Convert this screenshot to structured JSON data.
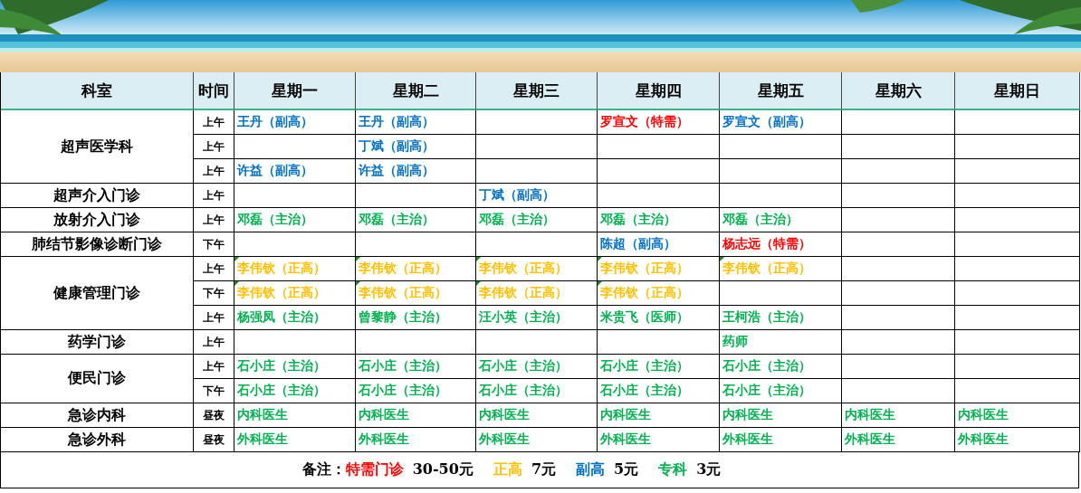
{
  "table": {
    "columns": [
      "科室",
      "时间",
      "星期一",
      "星期二",
      "星期三",
      "星期四",
      "星期五",
      "星期六",
      "星期日"
    ],
    "departments": [
      {
        "name": "超声医学科",
        "slots": [
          {
            "time": "上午",
            "cells": [
              {
                "text": "王丹（副高）",
                "color": "#0070c0",
                "marked": false
              },
              {
                "text": "王丹（副高）",
                "color": "#0070c0",
                "marked": false
              },
              null,
              {
                "text": "罗宣文（特需）",
                "color": "#ff0000",
                "marked": false
              },
              {
                "text": "罗宣文（副高）",
                "color": "#0070c0",
                "marked": false
              },
              null,
              null
            ]
          },
          {
            "time": "上午",
            "cells": [
              null,
              {
                "text": "丁斌（副高）",
                "color": "#0070c0",
                "marked": false
              },
              null,
              null,
              null,
              null,
              null
            ]
          },
          {
            "time": "上午",
            "cells": [
              {
                "text": "许益（副高）",
                "color": "#0070c0",
                "marked": false
              },
              {
                "text": "许益（副高）",
                "color": "#0070c0",
                "marked": false
              },
              null,
              null,
              null,
              null,
              null
            ]
          }
        ]
      },
      {
        "name": "超声介入门诊",
        "slots": [
          {
            "time": "上午",
            "cells": [
              null,
              null,
              {
                "text": "丁斌（副高）",
                "color": "#0070c0",
                "marked": false
              },
              null,
              null,
              null,
              null
            ]
          }
        ]
      },
      {
        "name": "放射介入门诊",
        "slots": [
          {
            "time": "上午",
            "cells": [
              {
                "text": "邓磊（主治）",
                "color": "#00b050",
                "marked": false
              },
              {
                "text": "邓磊（主治）",
                "color": "#00b050",
                "marked": false
              },
              {
                "text": "邓磊（主治）",
                "color": "#00b050",
                "marked": false
              },
              {
                "text": "邓磊（主治）",
                "color": "#00b050",
                "marked": false
              },
              {
                "text": "邓磊（主治）",
                "color": "#00b050",
                "marked": false
              },
              null,
              null
            ]
          }
        ]
      },
      {
        "name": "肺结节影像诊断门诊",
        "slots": [
          {
            "time": "下午",
            "cells": [
              null,
              null,
              null,
              {
                "text": "陈超（副高）",
                "color": "#0070c0",
                "marked": false
              },
              {
                "text": "杨志远（特需）",
                "color": "#ff0000",
                "marked": false
              },
              null,
              null
            ]
          }
        ]
      },
      {
        "name": "健康管理门诊",
        "slots": [
          {
            "time": "上午",
            "cells": [
              {
                "text": "李伟钦（正高）",
                "color": "#ffc000",
                "marked": true
              },
              {
                "text": "李伟钦（正高）",
                "color": "#ffc000",
                "marked": true
              },
              {
                "text": "李伟钦（正高）",
                "color": "#ffc000",
                "marked": true
              },
              {
                "text": "李伟钦（正高）",
                "color": "#ffc000",
                "marked": true
              },
              {
                "text": "李伟钦（正高）",
                "color": "#ffc000",
                "marked": true
              },
              null,
              null
            ]
          },
          {
            "time": "下午",
            "cells": [
              {
                "text": "李伟钦（正高）",
                "color": "#ffc000",
                "marked": true
              },
              {
                "text": "李伟钦（正高）",
                "color": "#ffc000",
                "marked": true
              },
              {
                "text": "李伟钦（正高）",
                "color": "#ffc000",
                "marked": true
              },
              {
                "text": "李伟钦（正高）",
                "color": "#ffc000",
                "marked": true
              },
              null,
              null,
              null
            ]
          },
          {
            "time": "上午",
            "cells": [
              {
                "text": "杨强凤（主治）",
                "color": "#00b050",
                "marked": false
              },
              {
                "text": "曾黎静（主治）",
                "color": "#00b050",
                "marked": false
              },
              {
                "text": "汪小英（主治）",
                "color": "#00b050",
                "marked": false
              },
              {
                "text": "米贵飞（医师）",
                "color": "#00b050",
                "marked": false
              },
              {
                "text": "王柯浩（主治）",
                "color": "#00b050",
                "marked": false
              },
              null,
              null
            ]
          }
        ]
      },
      {
        "name": "药学门诊",
        "slots": [
          {
            "time": "上午",
            "cells": [
              null,
              null,
              null,
              null,
              {
                "text": "药师",
                "color": "#00b050",
                "marked": false
              },
              null,
              null
            ]
          }
        ]
      },
      {
        "name": "便民门诊",
        "slots": [
          {
            "time": "上午",
            "cells": [
              {
                "text": "石小庄（主治）",
                "color": "#00b050",
                "marked": false
              },
              {
                "text": "石小庄（主治）",
                "color": "#00b050",
                "marked": false
              },
              {
                "text": "石小庄（主治）",
                "color": "#00b050",
                "marked": false
              },
              {
                "text": "石小庄（主治）",
                "color": "#00b050",
                "marked": false
              },
              {
                "text": "石小庄（主治）",
                "color": "#00b050",
                "marked": false
              },
              null,
              null
            ]
          },
          {
            "time": "下午",
            "cells": [
              {
                "text": "石小庄（主治）",
                "color": "#00b050",
                "marked": false
              },
              {
                "text": "石小庄（主治）",
                "color": "#00b050",
                "marked": false
              },
              {
                "text": "石小庄（主治）",
                "color": "#00b050",
                "marked": false
              },
              {
                "text": "石小庄（主治）",
                "color": "#00b050",
                "marked": false
              },
              {
                "text": "石小庄（主治）",
                "color": "#00b050",
                "marked": false
              },
              null,
              null
            ]
          }
        ]
      },
      {
        "name": "急诊内科",
        "slots": [
          {
            "time": "昼夜",
            "cells": [
              {
                "text": "内科医生",
                "color": "#00b050",
                "marked": false
              },
              {
                "text": "内科医生",
                "color": "#00b050",
                "marked": false
              },
              {
                "text": "内科医生",
                "color": "#00b050",
                "marked": false
              },
              {
                "text": "内科医生",
                "color": "#00b050",
                "marked": false
              },
              {
                "text": "内科医生",
                "color": "#00b050",
                "marked": false
              },
              {
                "text": "内科医生",
                "color": "#00b050",
                "marked": false
              },
              {
                "text": "内科医生",
                "color": "#00b050",
                "marked": false
              }
            ]
          }
        ]
      },
      {
        "name": "急诊外科",
        "slots": [
          {
            "time": "昼夜",
            "cells": [
              {
                "text": "外科医生",
                "color": "#00b050",
                "marked": false
              },
              {
                "text": "外科医生",
                "color": "#00b050",
                "marked": false
              },
              {
                "text": "外科医生",
                "color": "#00b050",
                "marked": false
              },
              {
                "text": "外科医生",
                "color": "#00b050",
                "marked": false
              },
              {
                "text": "外科医生",
                "color": "#00b050",
                "marked": false
              },
              {
                "text": "外科医生",
                "color": "#00b050",
                "marked": false
              },
              {
                "text": "外科医生",
                "color": "#00b050",
                "marked": false
              }
            ]
          }
        ]
      }
    ]
  },
  "note": [
    {
      "text": "备注：",
      "color": "#000000"
    },
    {
      "text": "特需门诊",
      "color": "#ff0000"
    },
    {
      "text": "30-50元",
      "color": "#000000"
    },
    {
      "text": "正高",
      "color": "#ffc000"
    },
    {
      "text": "7元",
      "color": "#000000"
    },
    {
      "text": "副高",
      "color": "#0070c0"
    },
    {
      "text": "5元",
      "color": "#000000"
    },
    {
      "text": "专科",
      "color": "#00b050"
    },
    {
      "text": "3元",
      "color": "#000000"
    }
  ]
}
